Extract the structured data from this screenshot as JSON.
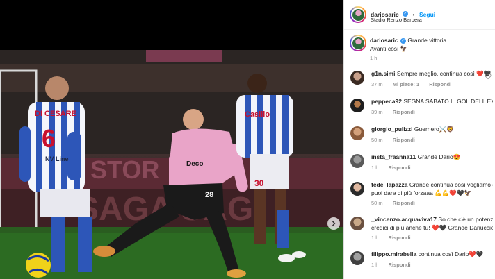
{
  "post": {
    "username": "dariosaric",
    "follow_label": "Segui",
    "location": "Stadio Renzo Barbera",
    "caption_line1": "Grande vittoria.",
    "caption_line2": "Avanti così 🦅",
    "caption_time": "1 h"
  },
  "photo": {
    "player_left_name": "DI CESARE",
    "player_left_number": "6",
    "player_left_sponsor": "NV Line",
    "player_center_number": "28",
    "player_center_sponsor": "Deco",
    "player_right_number": "30",
    "sponsor_right": "Casillo"
  },
  "comments": [
    {
      "user": "g1n.simi",
      "text": "Sempre meglio, continua così ",
      "emoji": "❤️🖤",
      "time": "37 m",
      "likes": "Mi piace: 1",
      "reply": "Rispondi"
    },
    {
      "user": "peppeca92",
      "text": "SEGNA SABATO IL GOL DELL EX ",
      "emoji": "🔥🔥",
      "time": "39 m",
      "likes": "",
      "reply": "Rispondi"
    },
    {
      "user": "giorgio_pulizzi",
      "text": "Guerriero",
      "emoji": "⚔️🦁",
      "time": "50 m",
      "likes": "",
      "reply": "Rispondi"
    },
    {
      "user": "insta_fraanna11",
      "text": "Grande Dario",
      "emoji": "😍",
      "time": "1 h",
      "likes": "",
      "reply": "Rispondi"
    },
    {
      "user": "fede_lapazza",
      "text": "Grande continua così vogliamo dj p",
      "text2": "puoi dare di più forzaaa ",
      "emoji": "💪💪❤️🖤🦅",
      "time": "50 m",
      "likes": "",
      "reply": "Rispondi"
    },
    {
      "user": "_vincenzo.acquaviva17",
      "text": "So che c'è un potenziale",
      "text2": "credici di più anche tu! ",
      "emoji": "❤️🖤 Grande Dariuccio",
      "time": "1 h",
      "likes": "",
      "reply": "Rispondi"
    },
    {
      "user": "filippo.mirabella",
      "text": "continua così Dario",
      "emoji": "❤️🖤",
      "time": "1 h",
      "likes": "",
      "reply": "Rispondi"
    }
  ],
  "colors": {
    "palermo_pink": "#e9a4c8",
    "link_blue": "#0095f6",
    "text_gray": "#8e8e8e"
  }
}
